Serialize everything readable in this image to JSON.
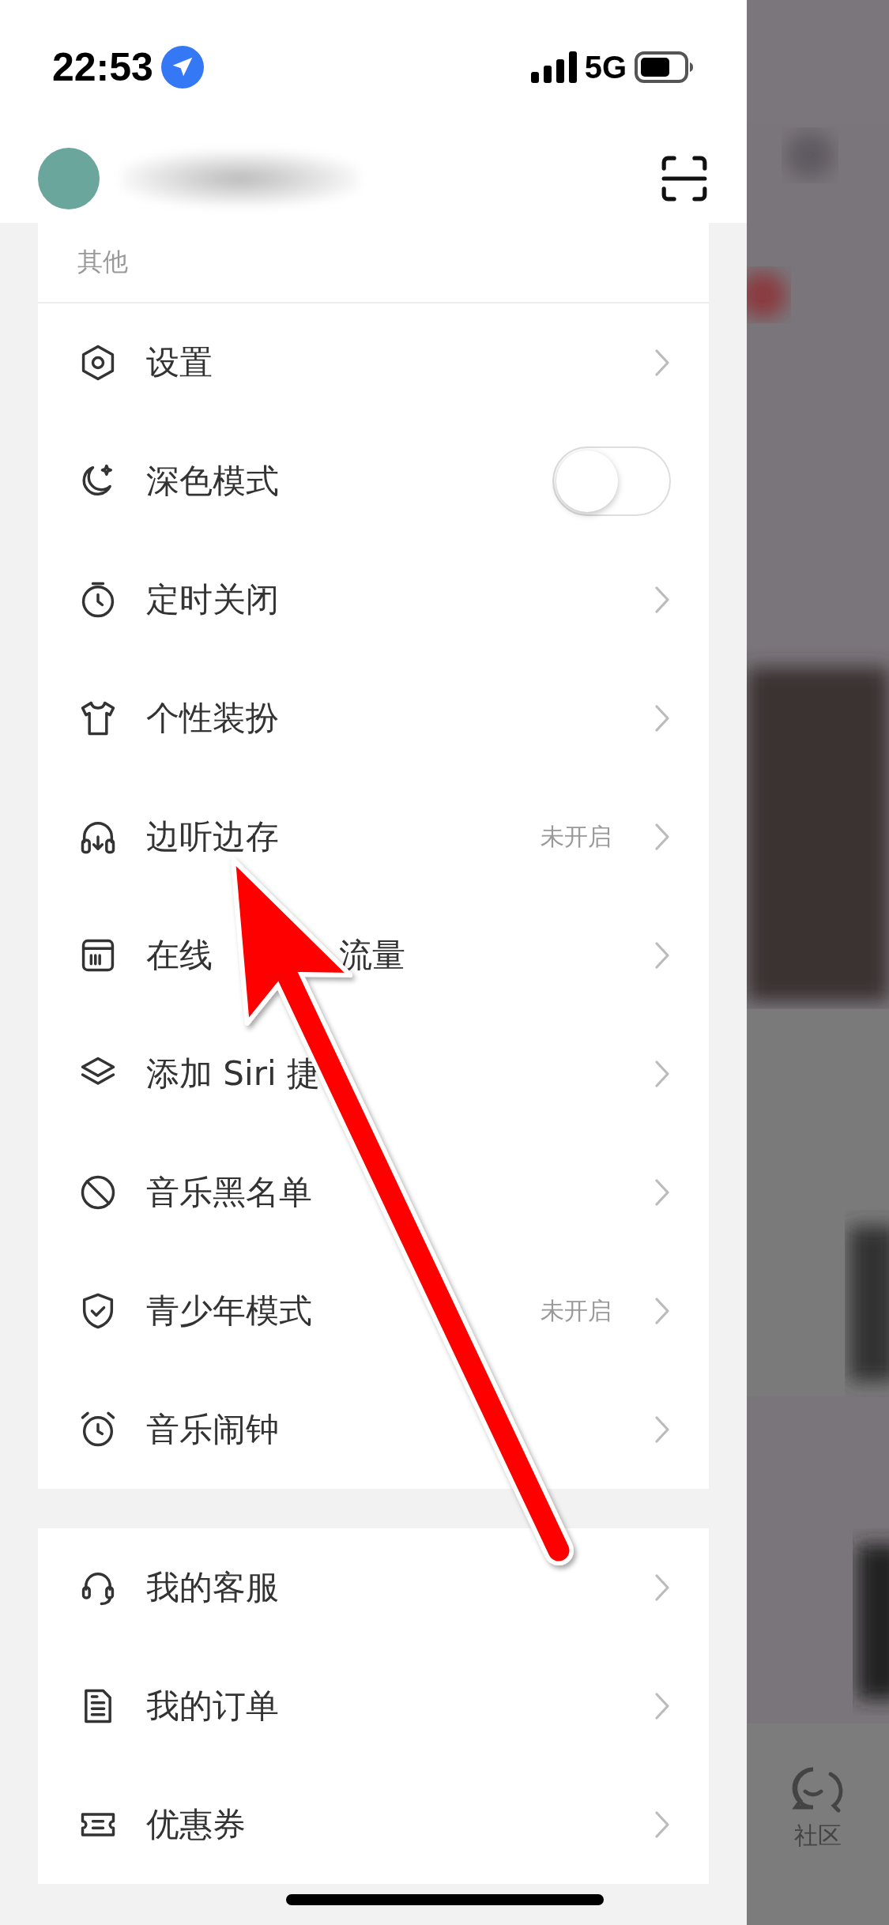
{
  "status_bar": {
    "time": "22:53",
    "network": "5G"
  },
  "sections": [
    {
      "title": "其他",
      "items": [
        {
          "kind": "link",
          "label": "设置"
        },
        {
          "kind": "toggle",
          "label": "深色模式",
          "on": false
        },
        {
          "kind": "link",
          "label": "定时关闭"
        },
        {
          "kind": "link",
          "label": "个性装扮"
        },
        {
          "kind": "link",
          "label": "边听边存",
          "status": "未开启"
        },
        {
          "kind": "link",
          "label": "在线",
          "label_tail": "流量"
        },
        {
          "kind": "link",
          "label": "添加 Siri 捷"
        },
        {
          "kind": "link",
          "label": "音乐黑名单"
        },
        {
          "kind": "link",
          "label": "青少年模式",
          "status": "未开启"
        },
        {
          "kind": "link",
          "label": "音乐闹钟"
        }
      ]
    },
    {
      "items": [
        {
          "kind": "link",
          "label": "我的客服"
        },
        {
          "kind": "link",
          "label": "我的订单"
        },
        {
          "kind": "link",
          "label": "优惠券"
        }
      ]
    }
  ],
  "backdrop": {
    "tab_label": "社区"
  }
}
